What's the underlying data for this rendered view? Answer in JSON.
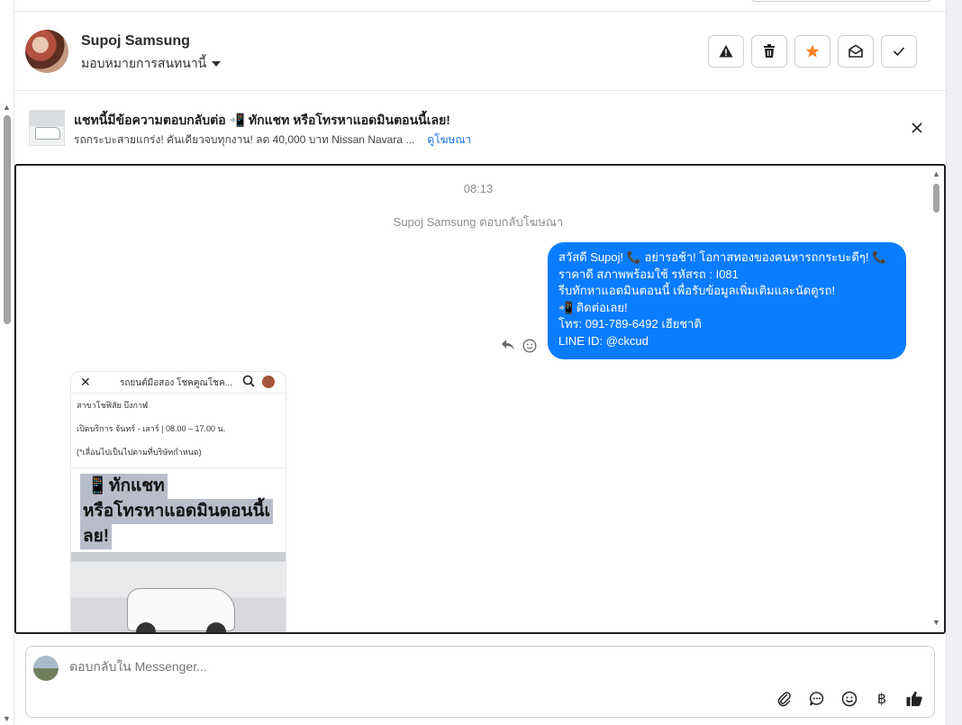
{
  "header": {
    "contact_name": "Supoj Samsung",
    "assign_label": "มอบหมายการสนทนานี้",
    "actions": [
      "warning-icon",
      "trash-icon",
      "star-icon",
      "mark-unread-icon",
      "check-icon"
    ],
    "star_color": "#f5821f"
  },
  "ad": {
    "title": "แชทนี้มีข้อความตอบกลับต่อ 📲 ทักแชท หรือโทรหาแอดมินตอนนี้เลย!",
    "subtitle": "รถกระบะสายแกร่ง! คันเดียวจบทุกงาน! ลด 40,000 บาท Nissan Navara ...",
    "link": "ดูโฆษณา"
  },
  "chat": {
    "time": "08:13",
    "replied_note": "Supoj Samsung ตอบกลับโฆษณา",
    "bubble_color": "#0a7cff",
    "message_lines": [
      "สวัสดี Supoj! 📞 อย่ารอช้า! โอกาสทองของคนหารถกระบะดีๆ! 📞",
      "ราคาดี สภาพพร้อมใช้ รหัสรถ : I081",
      "รีบทักหาแอดมินตอนนี้ เพื่อรับข้อมูลเพิ่มเติมและนัดดูรถ!",
      "📲 ติดต่อเลย!",
      "โทร: 091-789-6492 เฮียชาติ",
      "LINE ID: @ckcud"
    ],
    "card": {
      "top_title": "รถยนต์มือสอง โชคคูณโชค...",
      "lines": [
        "สาขาโชฟิสัย บึงกาฬ",
        "เปิดบริการ จันทร์ - เสาร์ | 08.00 – 17.00 น.",
        "(*เลื่อนไปเป็นไปตามที่บริษัทกำหนด)"
      ],
      "cta_lines": [
        "📲 ทักแชท",
        "หรือโทรหาแอดมินตอนนี้เ",
        "ลย!"
      ]
    }
  },
  "composer": {
    "placeholder": "ตอบกลับใน Messenger...",
    "tools": [
      "attachment-icon",
      "saved-reply-icon",
      "emoji-icon",
      "baht-icon",
      "thumbs-up-icon"
    ],
    "baht_symbol": "฿"
  }
}
